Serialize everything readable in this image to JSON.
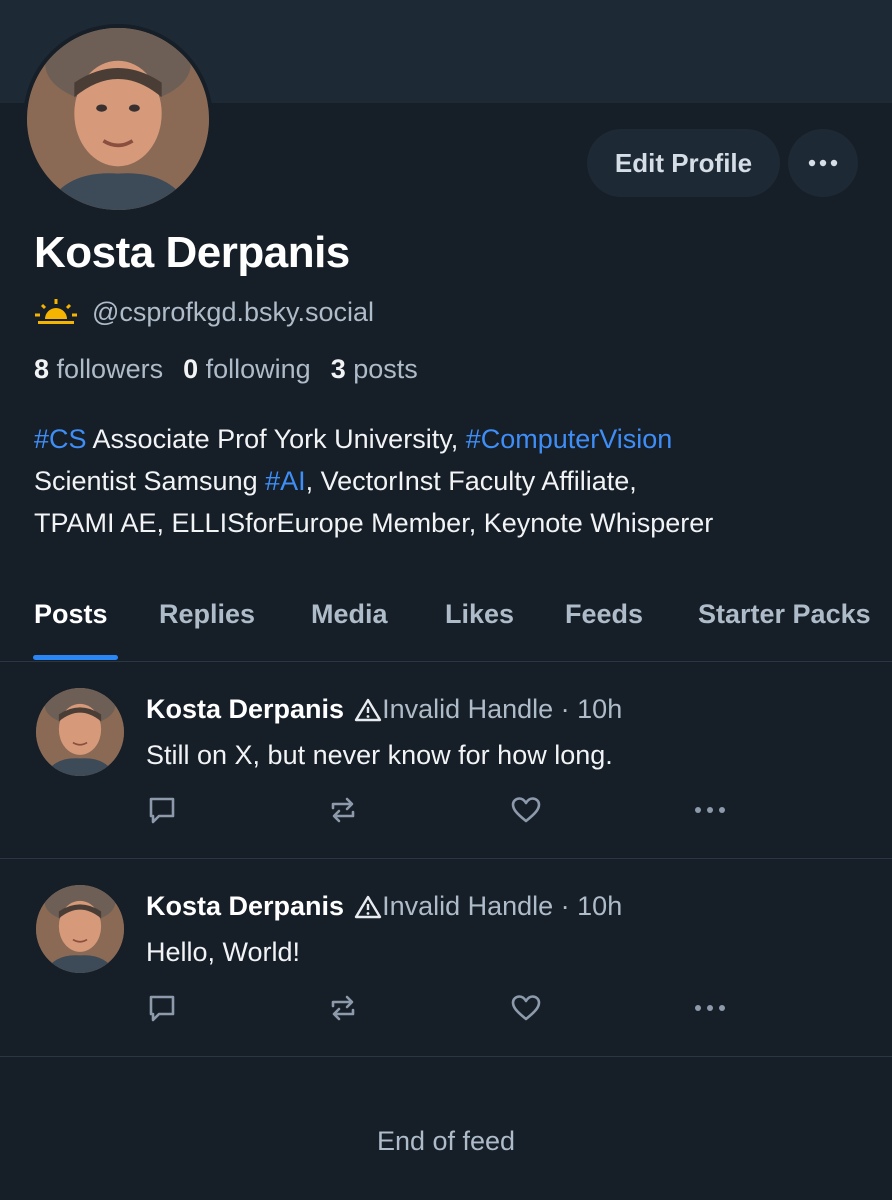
{
  "profile": {
    "name": "Kosta Derpanis",
    "handle": "@csprofkgd.bsky.social",
    "edit_label": "Edit Profile",
    "more_label": "More options",
    "stats": {
      "followers_count": "8",
      "followers_label": "followers",
      "following_count": "0",
      "following_label": "following",
      "posts_count": "3",
      "posts_label": "posts"
    },
    "bio": {
      "tag_cs": "#CS",
      "text1": " Associate Prof York University, ",
      "tag_cv": "#ComputerVision",
      "text2": "Scientist Samsung ",
      "tag_ai": "#AI",
      "text3": ", VectorInst Faculty Affiliate,",
      "text4": "TPAMI AE, ELLISforEurope Member, Keynote Whisperer"
    }
  },
  "tabs": [
    "Posts",
    "Replies",
    "Media",
    "Likes",
    "Feeds",
    "Starter Packs"
  ],
  "active_tab": "Posts",
  "posts": [
    {
      "author": "Kosta Derpanis",
      "meta": "Invalid Handle · 10h",
      "text": "Still on X, but never know for how long."
    },
    {
      "author": "Kosta Derpanis",
      "meta": "Invalid Handle · 10h",
      "text": "Hello, World!"
    }
  ],
  "end_of_feed": "End of feed",
  "colors": {
    "background": "#161e27",
    "banner": "#1e2936",
    "accent": "#2a85f5",
    "hashtag": "#3e8ef6",
    "muted_text": "#aebbc9",
    "sun_icon": "#f5b400"
  },
  "icons": {
    "handle_icon": "sunrise-icon",
    "warning_icon": "warning-triangle-icon",
    "reply_icon": "comment-icon",
    "repost_icon": "repost-icon",
    "like_icon": "heart-icon",
    "more_icon": "ellipsis-icon"
  }
}
